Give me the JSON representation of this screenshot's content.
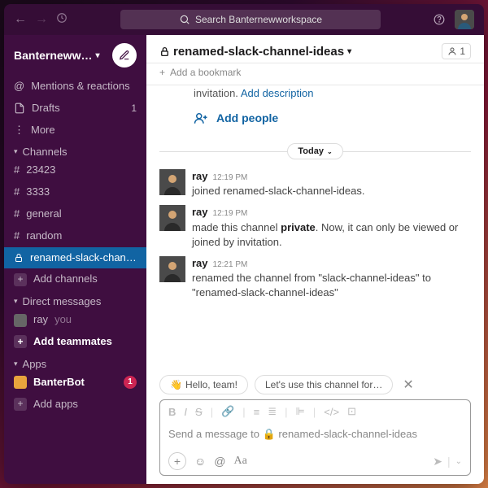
{
  "search": {
    "placeholder": "Search Banternewworkspace"
  },
  "workspace": {
    "name": "Banterneww…"
  },
  "sidebar": {
    "mentions": "Mentions & reactions",
    "drafts": "Drafts",
    "drafts_count": "1",
    "more": "More",
    "channels_label": "Channels",
    "channels": [
      {
        "prefix": "#",
        "name": "23423"
      },
      {
        "prefix": "#",
        "name": "3333"
      },
      {
        "prefix": "#",
        "name": "general"
      },
      {
        "prefix": "#",
        "name": "random"
      }
    ],
    "active_channel": "renamed-slack-chan…",
    "add_channels": "Add channels",
    "dm_label": "Direct messages",
    "dm_user": "ray",
    "dm_you": "you",
    "add_teammates": "Add teammates",
    "apps_label": "Apps",
    "app_name": "BanterBot",
    "app_badge": "1",
    "add_apps": "Add apps"
  },
  "channel": {
    "title": "renamed-slack-channel-ideas",
    "members": "1",
    "add_bookmark": "Add a bookmark",
    "intro_pre": "invitation. ",
    "intro_link": "Add description",
    "add_people": "Add people",
    "divider": "Today"
  },
  "messages": [
    {
      "user": "ray",
      "time": "12:19 PM",
      "text": "joined renamed-slack-channel-ideas."
    },
    {
      "user": "ray",
      "time": "12:19 PM",
      "text_pre": "made this channel ",
      "bold": "private",
      "text_post": ". Now, it can only be viewed or joined by invitation."
    },
    {
      "user": "ray",
      "time": "12:21 PM",
      "text": "renamed the channel from \"slack-channel-ideas\" to \"renamed-slack-channel-ideas\""
    }
  ],
  "suggestions": [
    "Hello, team!",
    "Let's use this channel for…"
  ],
  "composer": {
    "placeholder": "Send a message to 🔒 renamed-slack-channel-ideas"
  }
}
